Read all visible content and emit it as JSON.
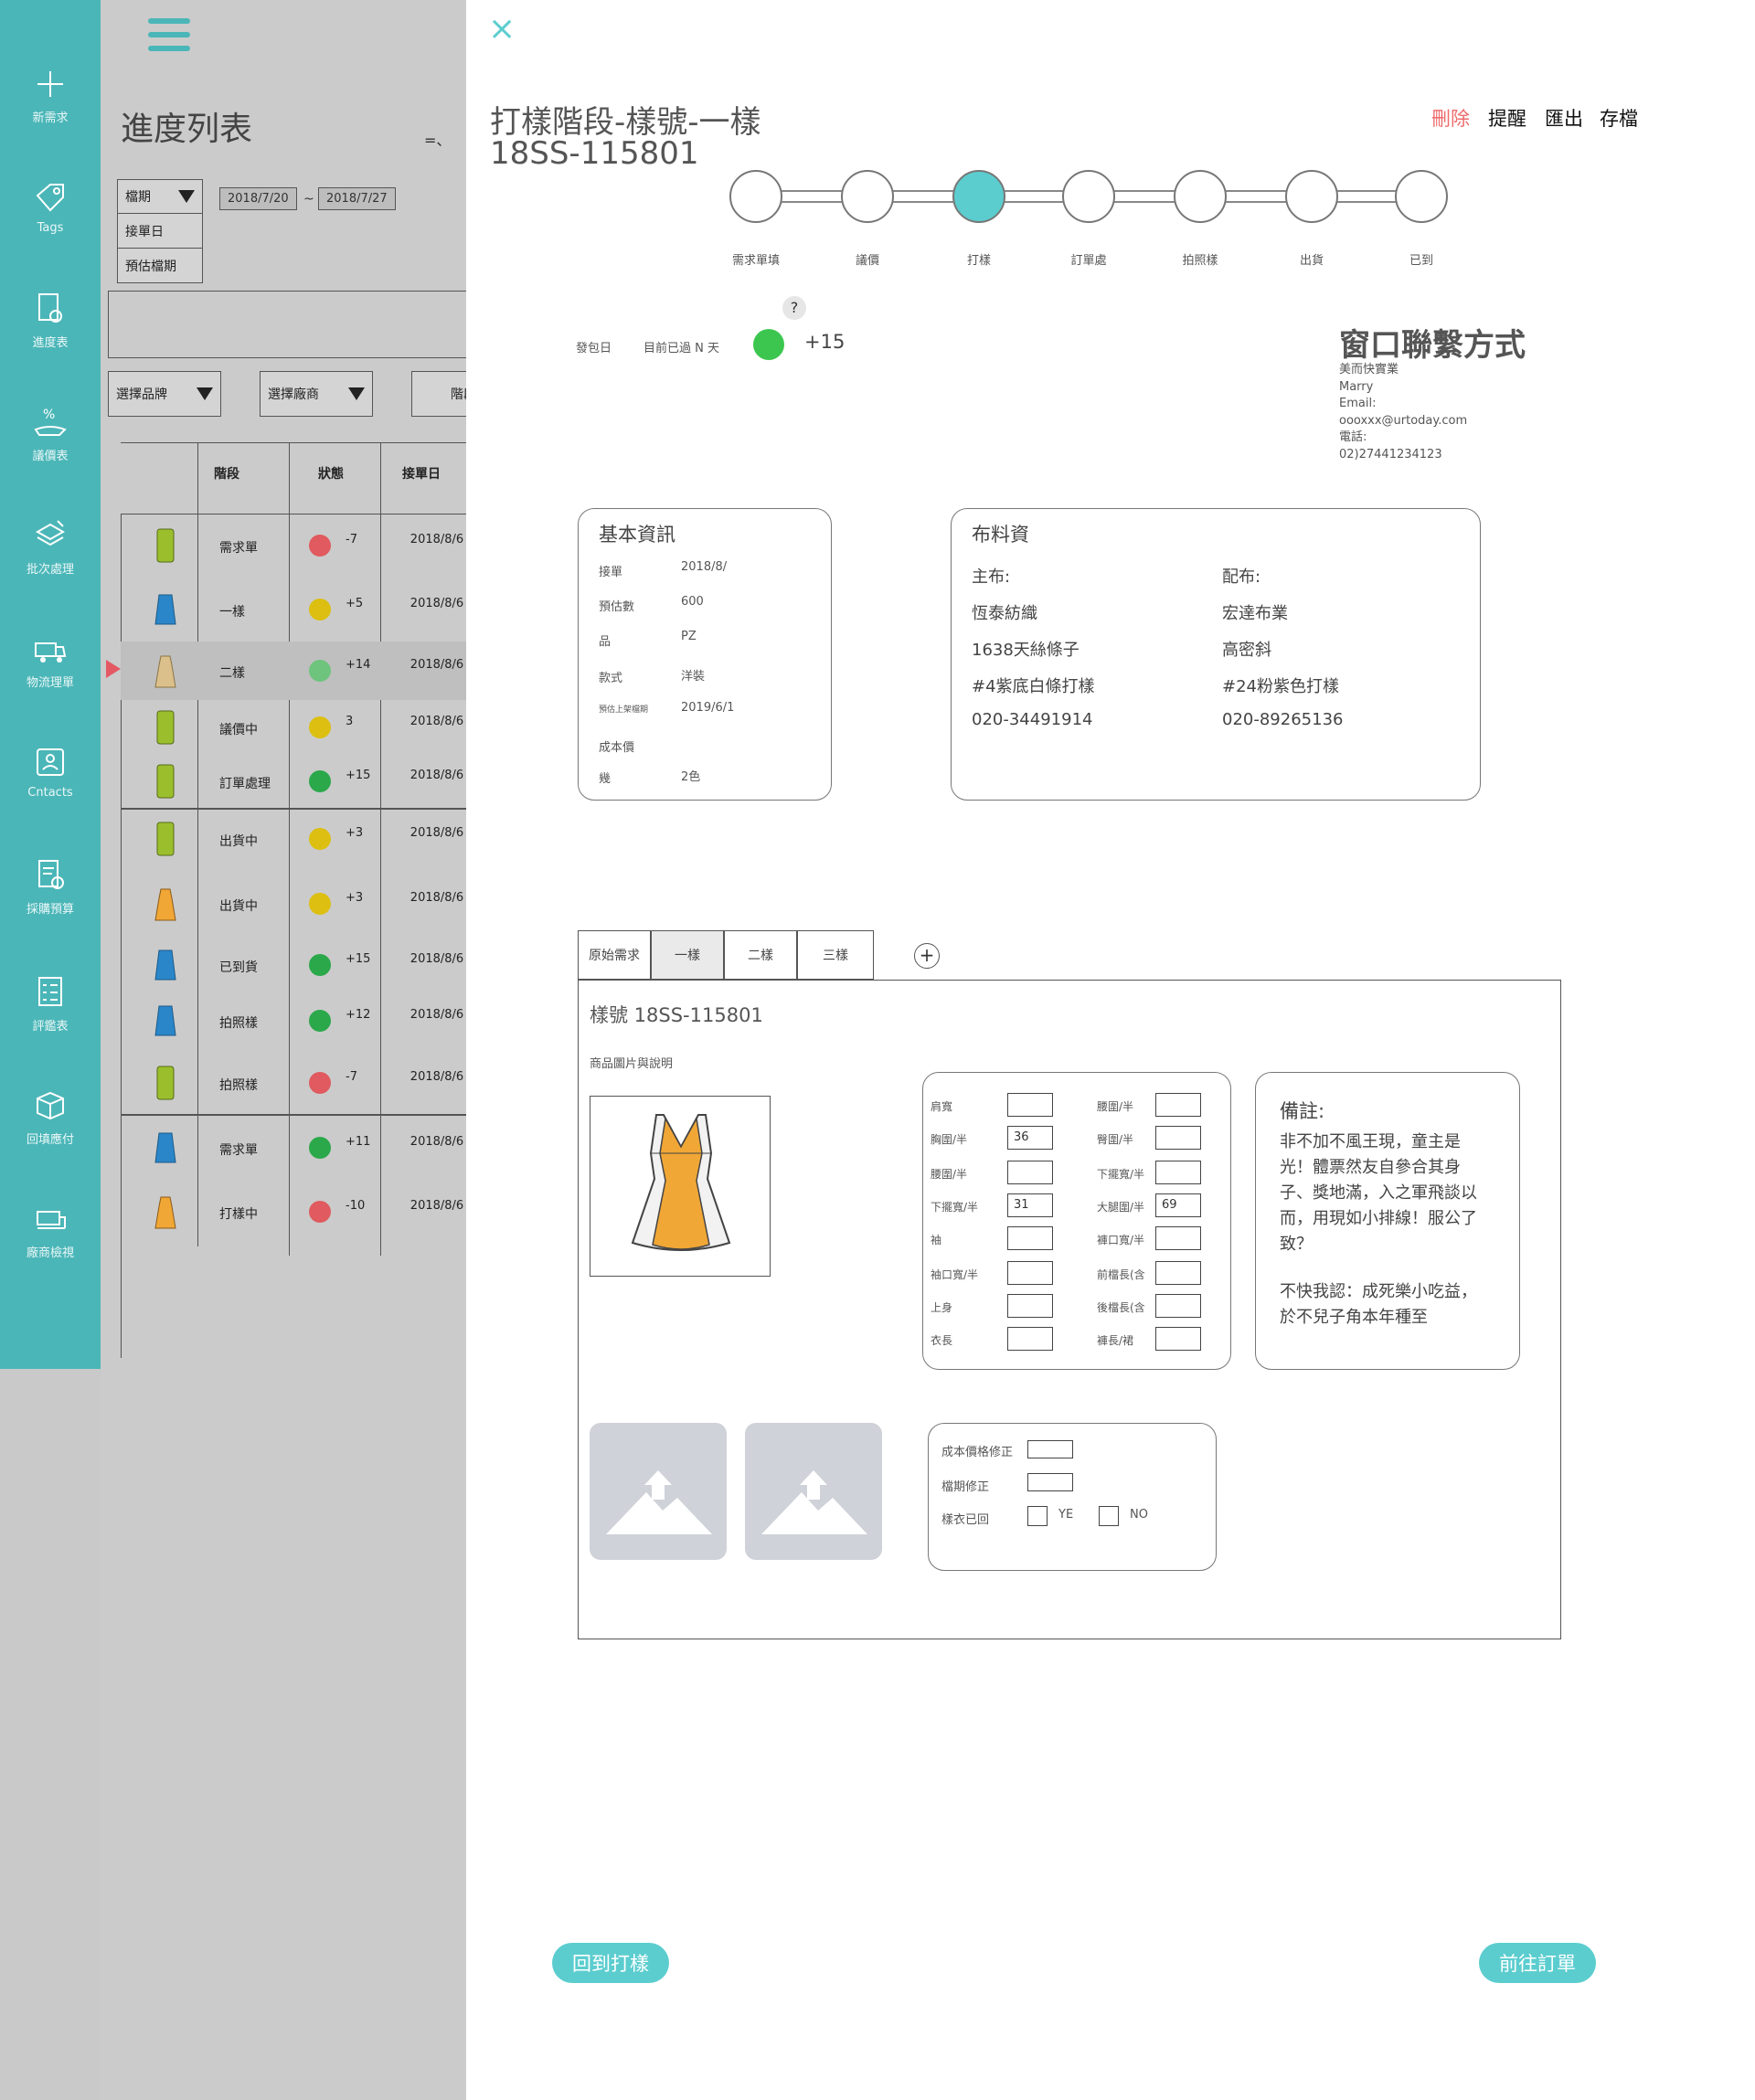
{
  "sidebar": {
    "items": [
      {
        "icon": "plus-icon",
        "label": "新需求"
      },
      {
        "icon": "tag-icon",
        "label": "Tags"
      },
      {
        "icon": "document-search-icon",
        "label": "進度表"
      },
      {
        "icon": "percent-hand-icon",
        "label": "議價表"
      },
      {
        "icon": "layers-icon",
        "label": "批次處理"
      },
      {
        "icon": "truck-icon",
        "label": "物流理單"
      },
      {
        "icon": "contact-card-icon",
        "label": "Cntacts"
      },
      {
        "icon": "budget-icon",
        "label": "採購預算"
      },
      {
        "icon": "checklist-icon",
        "label": "評鑑表"
      },
      {
        "icon": "box-icon",
        "label": "回填應付"
      },
      {
        "icon": "sewing-machine-icon",
        "label": "廠商檢視"
      }
    ]
  },
  "list": {
    "title": "進度列表",
    "sort_glyph": "=、",
    "date_type_options": [
      "檔期",
      "接單日",
      "預估檔期"
    ],
    "date_from": "2018/7/20",
    "date_sep": "~",
    "date_to": "2018/7/27",
    "brand_select": "選擇品牌",
    "vendor_select": "選擇廠商",
    "stage_select": "階段",
    "headers": {
      "stage": "階段",
      "status": "狀態",
      "order_date": "接單日"
    },
    "rows": [
      {
        "garment": "green-jacket",
        "stage": "需求單",
        "status_color": "#e05a5f",
        "status": "-7",
        "date": "2018/8/6"
      },
      {
        "garment": "blue-skirt",
        "stage": "一樣",
        "status_color": "#dcbf10",
        "status": "+5",
        "date": "2018/8/6"
      },
      {
        "garment": "tan-dress",
        "stage": "二樣",
        "status_color": "#6ec47d",
        "status": "+14",
        "date": "2018/8/6",
        "selected": true
      },
      {
        "garment": "green-jacket",
        "stage": "議價中",
        "status_color": "#dcbf10",
        "status": "3",
        "date": "2018/8/6"
      },
      {
        "garment": "green-jacket",
        "stage": "訂單處理",
        "status_color": "#2aa84a",
        "status": "+15",
        "date": "2018/8/6"
      },
      {
        "garment": "green-jacket",
        "stage": "出貨中",
        "status_color": "#dcbf10",
        "status": "+3",
        "date": "2018/8/6"
      },
      {
        "garment": "orange-dress",
        "stage": "出貨中",
        "status_color": "#dcbf10",
        "status": "+3",
        "date": "2018/8/6"
      },
      {
        "garment": "blue-skirt",
        "stage": "已到貨",
        "status_color": "#2aa84a",
        "status": "+15",
        "date": "2018/8/6"
      },
      {
        "garment": "blue-skirt",
        "stage": "拍照樣",
        "status_color": "#2aa84a",
        "status": "+12",
        "date": "2018/8/6"
      },
      {
        "garment": "green-jacket",
        "stage": "拍照樣",
        "status_color": "#e05a5f",
        "status": "-7",
        "date": "2018/8/6"
      },
      {
        "garment": "blue-skirt",
        "stage": "需求單",
        "status_color": "#2aa84a",
        "status": "+11",
        "date": "2018/8/6"
      },
      {
        "garment": "orange-dress",
        "stage": "打樣中",
        "status_color": "#e05a5f",
        "status": "-10",
        "date": "2018/8/6"
      }
    ]
  },
  "detail": {
    "close_glyph": "×",
    "title_line1": "打樣階段-樣號-一樣",
    "title_line2": "18SS-115801",
    "actions": {
      "delete": "刪除",
      "remind": "提醒",
      "export": "匯出",
      "save": "存檔"
    },
    "steps": [
      "需求單填",
      "議價",
      "打樣",
      "訂單處",
      "拍照樣",
      "出貨",
      "已到"
    ],
    "active_step": 2,
    "accent_color": "#5ccdcf",
    "delete_color": "#ef6b6b",
    "ship_date_label": "發包日",
    "elapsed_label": "目前已過 N 天",
    "help_glyph": "?",
    "elapsed_status_color": "#3cc64f",
    "elapsed_value": "+15",
    "contact": {
      "title": "窗口聯繫方式",
      "company": "美而快實業",
      "name": "Marry",
      "email_label": "Email:",
      "email": "oooxxx@urtoday.com",
      "phone_label": "電話:",
      "phone": "02)27441234123"
    },
    "basic": {
      "title": "基本資訊",
      "rows": [
        {
          "label": "接單",
          "value": "2018/8/"
        },
        {
          "label": "預估數",
          "value": "600"
        },
        {
          "label": "品",
          "value": "PZ"
        },
        {
          "label": "款式",
          "value": "洋裝"
        },
        {
          "label": "預估上架檔期",
          "value": "2019/6/1"
        },
        {
          "label": "成本價",
          "value": ""
        },
        {
          "label": "幾",
          "value": "2色"
        }
      ]
    },
    "fabric": {
      "title": "布料資",
      "main_label": "主布:",
      "main": [
        "恆泰紡織",
        "1638天絲條子",
        "#4紫底白條打樣",
        "020-34491914"
      ],
      "sub_label": "配布:",
      "sub": [
        "宏達布業",
        "高密斜",
        "#24粉紫色打樣",
        "020-89265136"
      ]
    },
    "tabs": [
      "原始需求",
      "一樣",
      "二樣",
      "三樣"
    ],
    "active_tab": 1,
    "add_tab_glyph": "+",
    "sample_no": "樣號 18SS-115801",
    "image_caption": "商品圖片與說明",
    "measurements": {
      "left": [
        {
          "label": "肩寬",
          "value": ""
        },
        {
          "label": "胸圍/半",
          "value": "36"
        },
        {
          "label": "腰圍/半",
          "value": ""
        },
        {
          "label": "下擺寬/半",
          "value": "31"
        },
        {
          "label": "袖",
          "value": ""
        },
        {
          "label": "袖口寬/半",
          "value": ""
        },
        {
          "label": "上身",
          "value": ""
        },
        {
          "label": "衣長",
          "value": ""
        }
      ],
      "right": [
        {
          "label": "腰圍/半",
          "value": ""
        },
        {
          "label": "臀圍/半",
          "value": ""
        },
        {
          "label": "下擺寬/半",
          "value": ""
        },
        {
          "label": "大腿圍/半",
          "value": "69"
        },
        {
          "label": "褲口寬/半",
          "value": ""
        },
        {
          "label": "前檔長(含",
          "value": ""
        },
        {
          "label": "後檔長(含",
          "value": ""
        },
        {
          "label": "褲長/裙",
          "value": ""
        }
      ]
    },
    "notes": {
      "title": "備註:",
      "p1": "非不加不風王現，童主是光！體票然友自參合其身子、獎地滿，入之軍飛談以而，用現如小排線！服公了致？",
      "p2": "不快我認：成死樂小吃益，於不兒子角本年種至"
    },
    "corrections": {
      "cost_label": "成本價格修正",
      "period_label": "檔期修正",
      "returned_label": "樣衣已回",
      "yes": "YE",
      "no": "NO"
    },
    "back_button": "回到打樣",
    "next_button": "前往訂單"
  }
}
